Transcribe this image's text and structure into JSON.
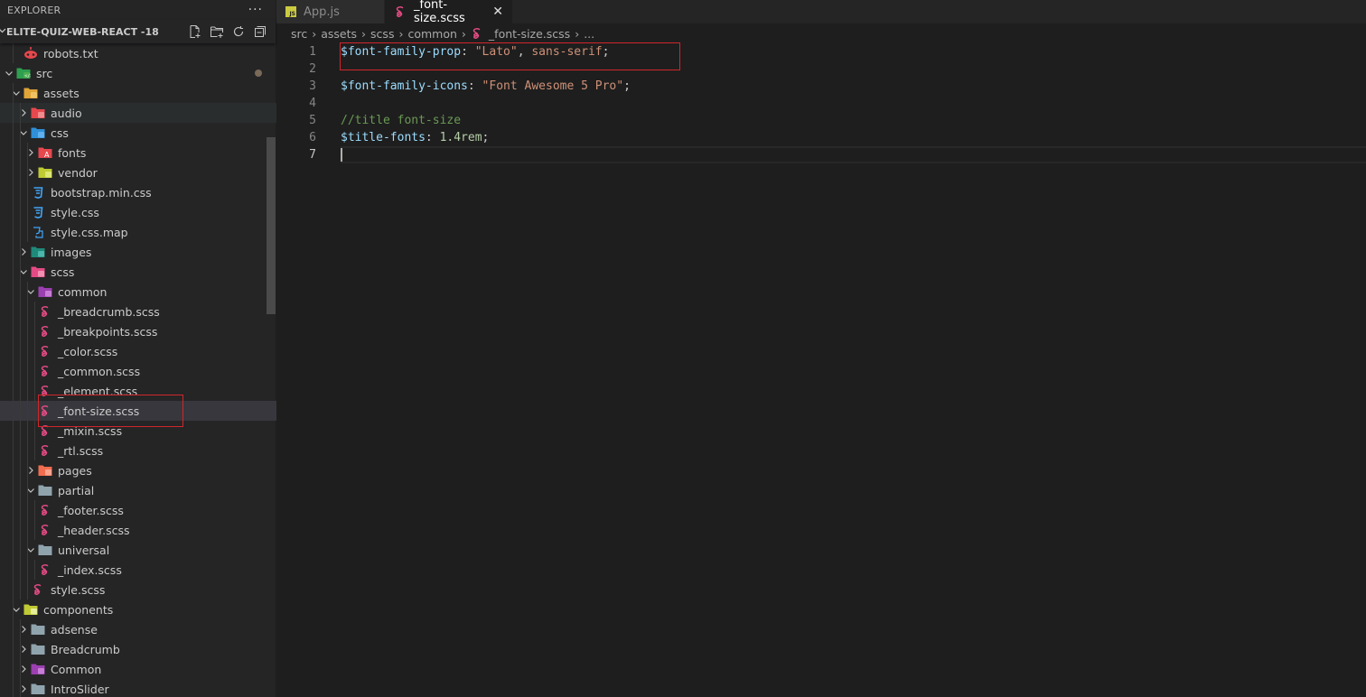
{
  "sidebar": {
    "title": "EXPLORER",
    "more_label": "···",
    "project_name": "ELITE-QUIZ-WEB-REACT -18",
    "actions": [
      {
        "name": "new-file",
        "label": "New File"
      },
      {
        "name": "new-folder",
        "label": "New Folder"
      },
      {
        "name": "refresh",
        "label": "Refresh Explorer"
      },
      {
        "name": "collapse-all",
        "label": "Collapse Folders"
      }
    ],
    "tree": [
      {
        "label": "robots.txt",
        "type": "file",
        "icon": "robot-icon",
        "depth": 1
      },
      {
        "label": "src",
        "type": "folder",
        "expanded": true,
        "icon": "folder-src-icon",
        "depth": 0,
        "modified": true
      },
      {
        "label": "assets",
        "type": "folder",
        "expanded": true,
        "icon": "folder-assets-icon",
        "depth": 1
      },
      {
        "label": "audio",
        "type": "folder",
        "expanded": false,
        "icon": "folder-audio-icon",
        "depth": 2
      },
      {
        "label": "css",
        "type": "folder",
        "expanded": true,
        "icon": "folder-css-icon",
        "depth": 2
      },
      {
        "label": "fonts",
        "type": "folder",
        "expanded": false,
        "icon": "folder-fonts-icon",
        "depth": 3
      },
      {
        "label": "vendor",
        "type": "folder",
        "expanded": false,
        "icon": "folder-vendor-icon",
        "depth": 3
      },
      {
        "label": "bootstrap.min.css",
        "type": "file",
        "icon": "css-file-icon",
        "depth": 3
      },
      {
        "label": "style.css",
        "type": "file",
        "icon": "css-file-icon",
        "depth": 3
      },
      {
        "label": "style.css.map",
        "type": "file",
        "icon": "css-map-file-icon",
        "depth": 3
      },
      {
        "label": "images",
        "type": "folder",
        "expanded": false,
        "icon": "folder-images-icon",
        "depth": 2
      },
      {
        "label": "scss",
        "type": "folder",
        "expanded": true,
        "icon": "folder-scss-icon",
        "depth": 2
      },
      {
        "label": "common",
        "type": "folder",
        "expanded": true,
        "icon": "folder-common-icon",
        "depth": 3
      },
      {
        "label": "_breadcrumb.scss",
        "type": "file",
        "icon": "sass-file-icon",
        "depth": 4
      },
      {
        "label": "_breakpoints.scss",
        "type": "file",
        "icon": "sass-file-icon",
        "depth": 4
      },
      {
        "label": "_color.scss",
        "type": "file",
        "icon": "sass-file-icon",
        "depth": 4
      },
      {
        "label": "_common.scss",
        "type": "file",
        "icon": "sass-file-icon",
        "depth": 4
      },
      {
        "label": "_element.scss",
        "type": "file",
        "icon": "sass-file-icon",
        "depth": 4
      },
      {
        "label": "_font-size.scss",
        "type": "file",
        "icon": "sass-file-icon",
        "depth": 4,
        "selected": true
      },
      {
        "label": "_mixin.scss",
        "type": "file",
        "icon": "sass-file-icon",
        "depth": 4
      },
      {
        "label": "_rtl.scss",
        "type": "file",
        "icon": "sass-file-icon",
        "depth": 4
      },
      {
        "label": "pages",
        "type": "folder",
        "expanded": false,
        "icon": "folder-pages-icon",
        "depth": 3
      },
      {
        "label": "partial",
        "type": "folder",
        "expanded": true,
        "icon": "folder-plain-icon",
        "depth": 3
      },
      {
        "label": "_footer.scss",
        "type": "file",
        "icon": "sass-file-icon",
        "depth": 4
      },
      {
        "label": "_header.scss",
        "type": "file",
        "icon": "sass-file-icon",
        "depth": 4
      },
      {
        "label": "universal",
        "type": "folder",
        "expanded": true,
        "icon": "folder-plain-icon",
        "depth": 3
      },
      {
        "label": "_index.scss",
        "type": "file",
        "icon": "sass-file-icon",
        "depth": 4
      },
      {
        "label": "style.scss",
        "type": "file",
        "icon": "sass-file-icon",
        "depth": 3
      },
      {
        "label": "components",
        "type": "folder",
        "expanded": true,
        "icon": "folder-components-icon",
        "depth": 1
      },
      {
        "label": "adsense",
        "type": "folder",
        "expanded": false,
        "icon": "folder-plain-icon",
        "depth": 2
      },
      {
        "label": "Breadcrumb",
        "type": "folder",
        "expanded": false,
        "icon": "folder-plain-icon",
        "depth": 2
      },
      {
        "label": "Common",
        "type": "folder",
        "expanded": false,
        "icon": "folder-common-icon",
        "depth": 2
      },
      {
        "label": "IntroSlider",
        "type": "folder",
        "expanded": false,
        "icon": "folder-plain-icon",
        "depth": 2
      }
    ]
  },
  "tabs": [
    {
      "label": "App.js",
      "icon": "js-file-icon",
      "active": false
    },
    {
      "label": "_font-size.scss",
      "icon": "sass-file-icon",
      "active": true,
      "close_label": "✕"
    }
  ],
  "breadcrumb": {
    "items": [
      "src",
      "assets",
      "scss",
      "common",
      "_font-size.scss",
      "..."
    ],
    "separator": "›"
  },
  "editor": {
    "cursor_line": 7,
    "lines": [
      {
        "n": "1",
        "tokens": [
          {
            "t": "var",
            "v": "$font-family-prop"
          },
          {
            "t": "punc",
            "v": ": "
          },
          {
            "t": "str",
            "v": "\"Lato\""
          },
          {
            "t": "punc",
            "v": ", "
          },
          {
            "t": "str",
            "v": "sans-serif"
          },
          {
            "t": "punc",
            "v": ";"
          }
        ]
      },
      {
        "n": "2",
        "tokens": []
      },
      {
        "n": "3",
        "tokens": [
          {
            "t": "var",
            "v": "$font-family-icons"
          },
          {
            "t": "punc",
            "v": ": "
          },
          {
            "t": "str",
            "v": "\"Font Awesome 5 Pro\""
          },
          {
            "t": "punc",
            "v": ";"
          }
        ]
      },
      {
        "n": "4",
        "tokens": []
      },
      {
        "n": "5",
        "tokens": [
          {
            "t": "com",
            "v": "//title font-size"
          }
        ]
      },
      {
        "n": "6",
        "tokens": [
          {
            "t": "var",
            "v": "$title-fonts"
          },
          {
            "t": "punc",
            "v": ": "
          },
          {
            "t": "num",
            "v": "1.4rem"
          },
          {
            "t": "punc",
            "v": ";"
          }
        ]
      },
      {
        "n": "7",
        "tokens": []
      }
    ]
  },
  "colors": {
    "annotation_box": "#d0262b",
    "sass_pink": "#e44b84",
    "selection_bg": "#37373d"
  }
}
